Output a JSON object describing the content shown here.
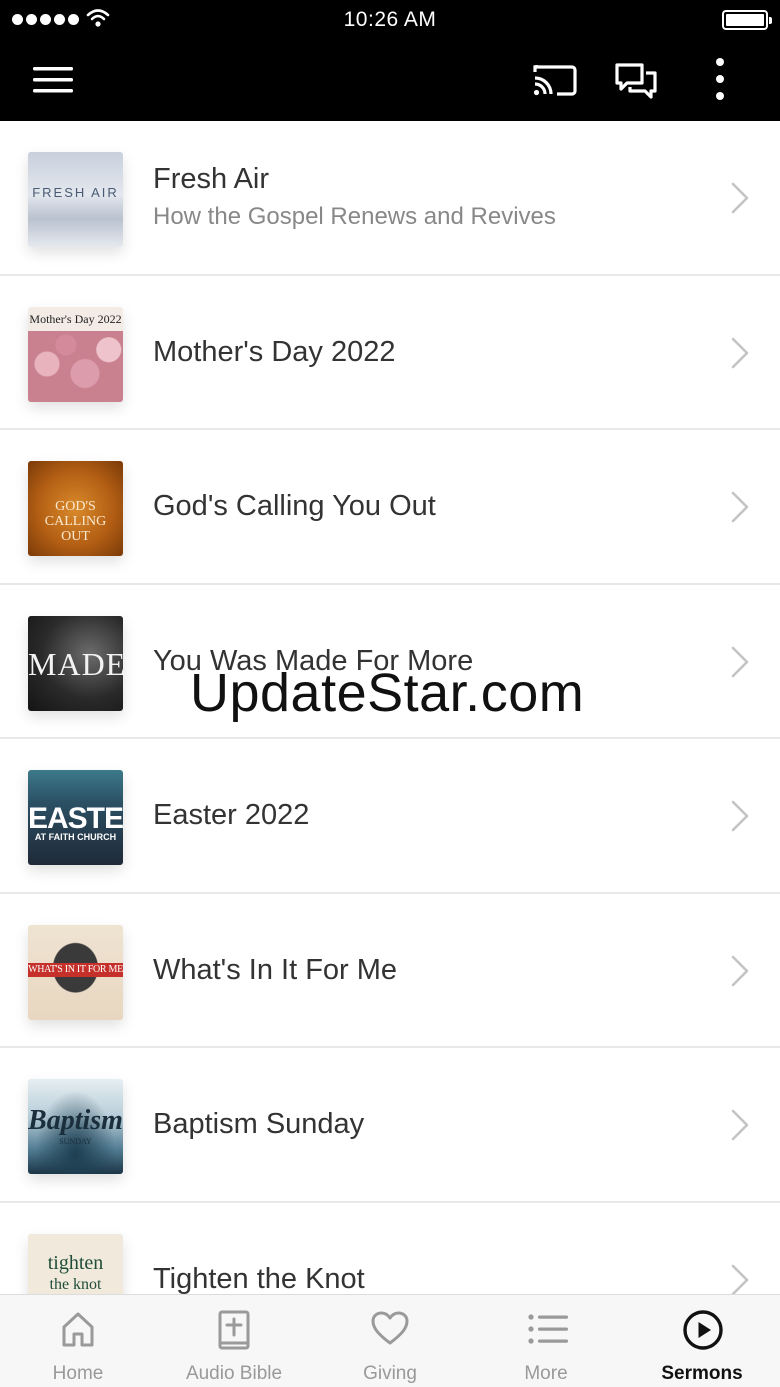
{
  "status_bar": {
    "time": "10:26 AM"
  },
  "app_bar": {
    "icons": [
      "menu-icon",
      "cast-icon",
      "chat-icon",
      "more-vertical-icon"
    ]
  },
  "sermon_series": [
    {
      "title": "Fresh Air",
      "subtitle": "How the Gospel Renews and Revives",
      "artwork_text": "FRESH AIR"
    },
    {
      "title": "Mother's Day 2022",
      "artwork_text": "Mother's Day 2022"
    },
    {
      "title": "God's Calling You Out",
      "artwork_text": "GOD'S CALLING OUT"
    },
    {
      "title": "You Was Made For More",
      "artwork_text": "MADE"
    },
    {
      "title": "Easter 2022",
      "artwork_text": "EASTER",
      "artwork_subtext": "AT FAITH CHURCH"
    },
    {
      "title": "What's In It For Me",
      "artwork_text": "WHAT'S IN IT FOR ME"
    },
    {
      "title": "Baptism Sunday",
      "artwork_text": "Baptism",
      "artwork_subtext": "SUNDAY"
    },
    {
      "title": "Tighten the Knot",
      "artwork_text": "tighten",
      "artwork_subtext": "the knot"
    }
  ],
  "watermark": "UpdateStar.com",
  "tab_bar": {
    "tabs": [
      {
        "label": "Home",
        "icon": "home-icon",
        "active": false
      },
      {
        "label": "Audio Bible",
        "icon": "bible-icon",
        "active": false
      },
      {
        "label": "Giving",
        "icon": "heart-icon",
        "active": false
      },
      {
        "label": "More",
        "icon": "list-icon",
        "active": false
      },
      {
        "label": "Sermons",
        "icon": "play-circle-icon",
        "active": true
      }
    ]
  },
  "colors": {
    "bar_background": "#000000",
    "title_text": "#333333",
    "subtitle_text": "#888888",
    "inactive_tab": "#999999",
    "active_tab": "#111111"
  }
}
